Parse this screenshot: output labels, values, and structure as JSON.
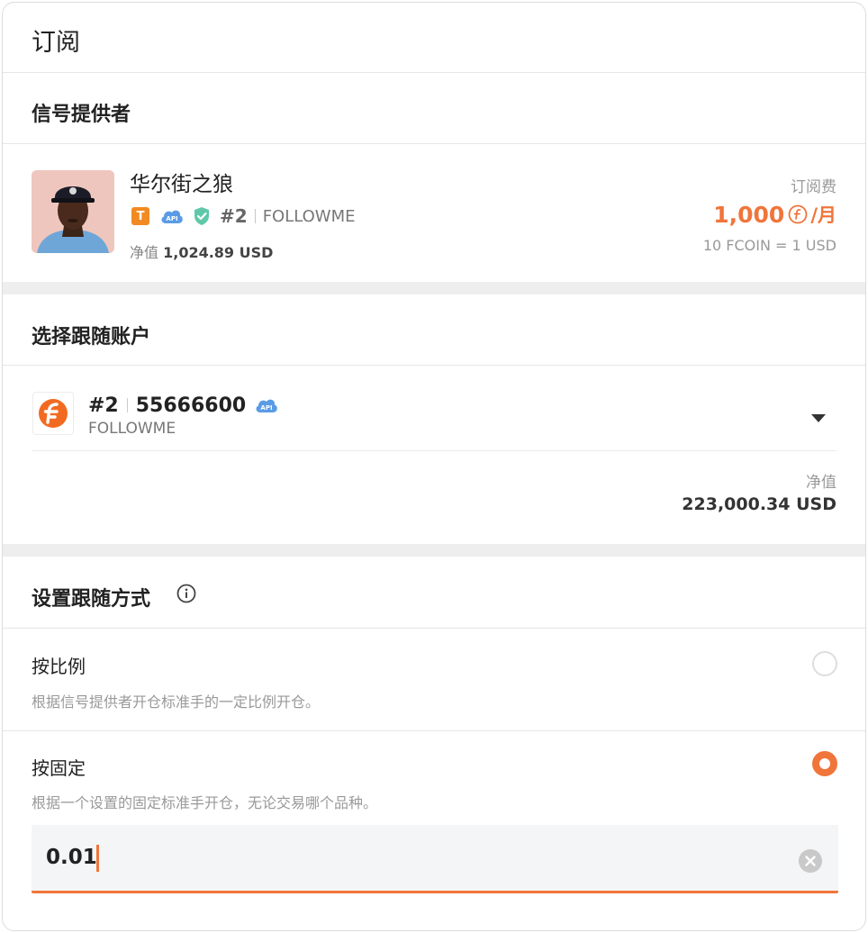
{
  "header": {
    "title": "订阅"
  },
  "provider_section": {
    "title": "信号提供者",
    "name": "华尔街之狼",
    "badge_t": "T",
    "api_label": "API",
    "rank": "#2",
    "broker": "FOLLOWME",
    "equity_label": "净值",
    "equity_value": "1,024.89 USD",
    "fee_label": "订阅费",
    "fee_amount": "1,000",
    "fee_unit": "/月",
    "fee_rate": "10 FCOIN = 1 USD"
  },
  "account_section": {
    "title": "选择跟随账户",
    "rank": "#2",
    "account_number": "55666600",
    "api_label": "API",
    "broker": "FOLLOWME",
    "net_label": "净值",
    "net_value": "223,000.34 USD"
  },
  "method_section": {
    "title": "设置跟随方式",
    "options": [
      {
        "title": "按比例",
        "description": "根据信号提供者开仓标准手的一定比例开仓。",
        "selected": false
      },
      {
        "title": "按固定",
        "description": "根据一个设置的固定标准手开仓，无论交易哪个品种。",
        "selected": true
      }
    ],
    "input_value": "0.01"
  },
  "colors": {
    "accent": "#f0753a",
    "badge_orange": "#f28a23",
    "api_blue": "#5b9be6",
    "shield_green": "#5fc8a8"
  }
}
